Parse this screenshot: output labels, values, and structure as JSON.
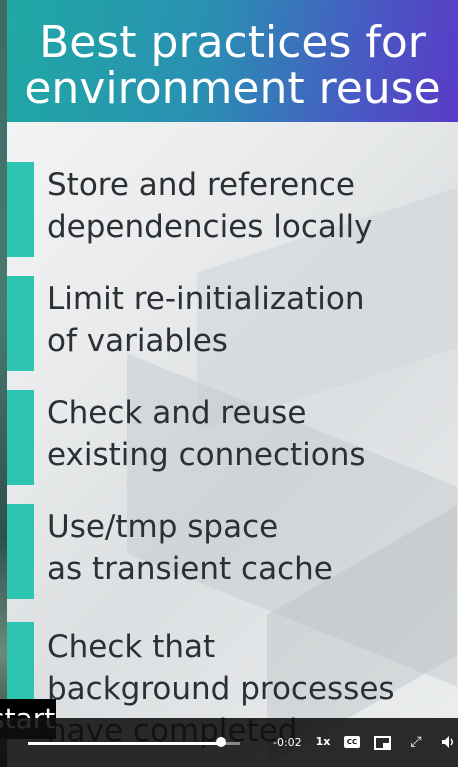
{
  "slide": {
    "title_lines": [
      "Best practices for",
      "environment reuse"
    ],
    "items": [
      {
        "lines": [
          "Store and reference",
          "dependencies locally"
        ]
      },
      {
        "lines": [
          "Limit re-initialization",
          "of variables"
        ]
      },
      {
        "lines": [
          "Check and reuse",
          "existing connections"
        ]
      },
      {
        "lines": [
          "Use/tmp space",
          "as transient cache"
        ]
      },
      {
        "lines": [
          "Check that",
          "background processes",
          "have completed"
        ]
      }
    ],
    "colors": {
      "accent_bar": "#2ec4b2",
      "title_gradient_start": "#1fa9a3",
      "title_gradient_end": "#5a3bc6"
    }
  },
  "caption": {
    "text": "start."
  },
  "player": {
    "time": "-0:02",
    "speed_label": "1x",
    "cc_label": "CC",
    "progress_fraction": 0.91,
    "icons": {
      "captions": "closed-captions-icon",
      "pip": "picture-in-picture-icon",
      "fullscreen": "exit-fullscreen-icon",
      "volume": "volume-icon"
    }
  }
}
